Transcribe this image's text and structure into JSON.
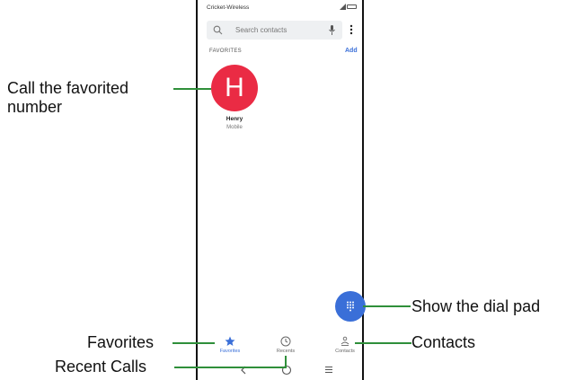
{
  "status_bar": {
    "carrier": "Cricket-Wireless"
  },
  "search": {
    "placeholder": "Search contacts"
  },
  "favorites": {
    "header": "FAVORITES",
    "add_label": "Add",
    "contacts": [
      {
        "initial": "H",
        "name": "Henry",
        "type": "Mobile",
        "avatar_color": "#ea2b44"
      }
    ]
  },
  "bottom_nav": {
    "items": [
      {
        "label": "Favorites",
        "icon": "star-icon",
        "active": true
      },
      {
        "label": "Recents",
        "icon": "clock-icon",
        "active": false
      },
      {
        "label": "Contacts",
        "icon": "people-icon",
        "active": false
      }
    ]
  },
  "system_nav": {
    "icons": [
      "back-icon",
      "home-icon",
      "menu-icon"
    ]
  },
  "callouts": {
    "call_favorite_line1": "Call the favorited",
    "call_favorite_line2": "number",
    "dial_pad": "Show the dial pad",
    "favorites": "Favorites",
    "contacts": "Contacts",
    "recent_calls": "Recent Calls"
  },
  "colors": {
    "accent": "#3a6fd8",
    "callout_line": "#2f8f3a",
    "avatar": "#ea2b44"
  }
}
